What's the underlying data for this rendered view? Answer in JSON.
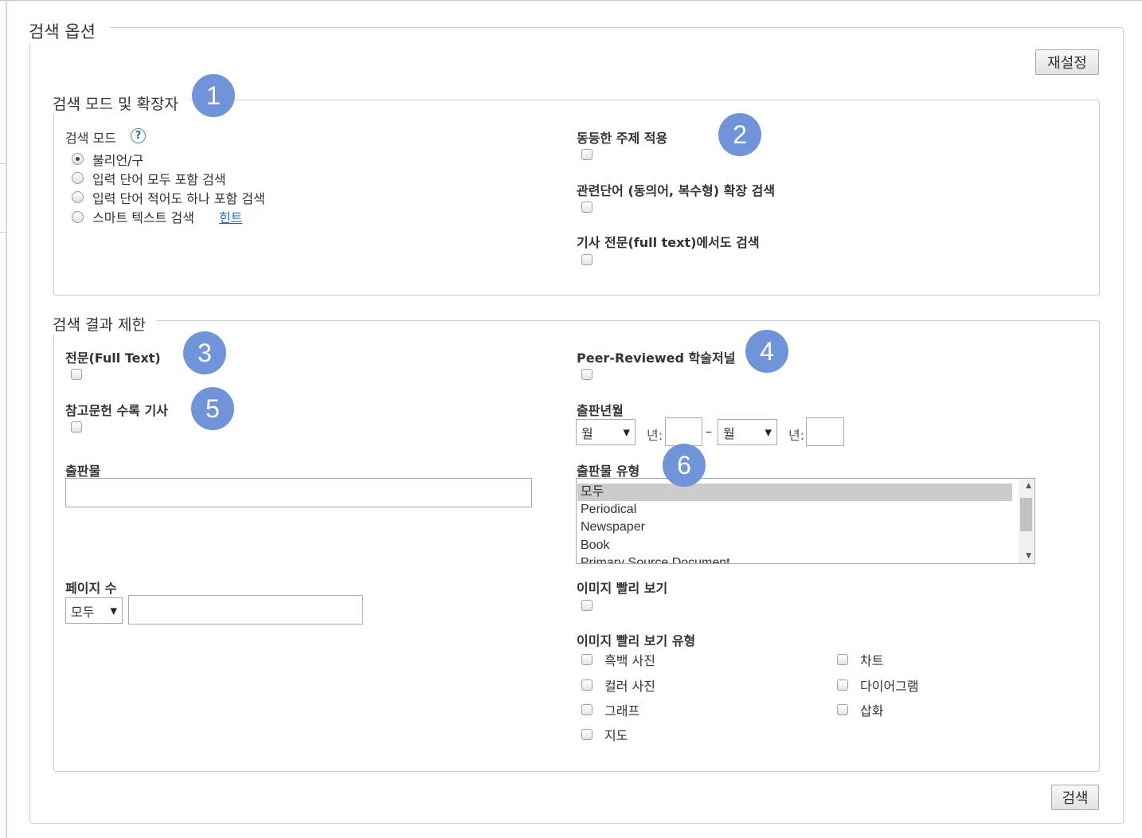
{
  "search_options": {
    "title": "검색 옵션",
    "reset_button": "재설정",
    "search_button": "검색"
  },
  "mode_section": {
    "title": "검색 모드 및 확장자",
    "search_mode_label": "검색 모드",
    "help_icon": "?",
    "radio_options": [
      "불리언/구",
      "입력 단어 모두 포함 검색",
      "입력 단어 적어도 하나 포함 검색",
      "스마트 텍스트 검색"
    ],
    "selected_mode": "불리언/구",
    "hint_link": "힌트",
    "equivalent_subjects": "동등한 주제 적용",
    "related_words": "관련단어 (동의어, 복수형) 확장 검색",
    "full_text_search": "기사 전문(full text)에서도 검색"
  },
  "limit_section": {
    "title": "검색 결과 제한",
    "full_text": "전문(Full Text)",
    "peer_reviewed": "Peer-Reviewed 학술저널",
    "references": "참고문헌 수록 기사",
    "pub_date_label": "출판년월",
    "month_select": "월",
    "year_label": "년:",
    "dash": "–",
    "publication_label": "출판물",
    "pub_type_label": "출판물 유형",
    "pub_types": [
      "모두",
      "Periodical",
      "Newspaper",
      "Book",
      "Primary Source Document"
    ],
    "selected_pub_type": "모두",
    "page_count_label": "페이지 수",
    "page_count_select": "모두",
    "image_quickview": "이미지 빨리 보기",
    "image_quickview_types_label": "이미지 빨리 보기 유형",
    "image_types": [
      "흑백 사진",
      "컬러 사진",
      "그래프",
      "지도",
      "차트",
      "다이어그램",
      "삽화"
    ]
  },
  "annotations": [
    "1",
    "2",
    "3",
    "4",
    "5",
    "6"
  ],
  "colors": {
    "badge": "#6f94d9",
    "link": "#1a6fc0",
    "border": "#cccccc"
  }
}
